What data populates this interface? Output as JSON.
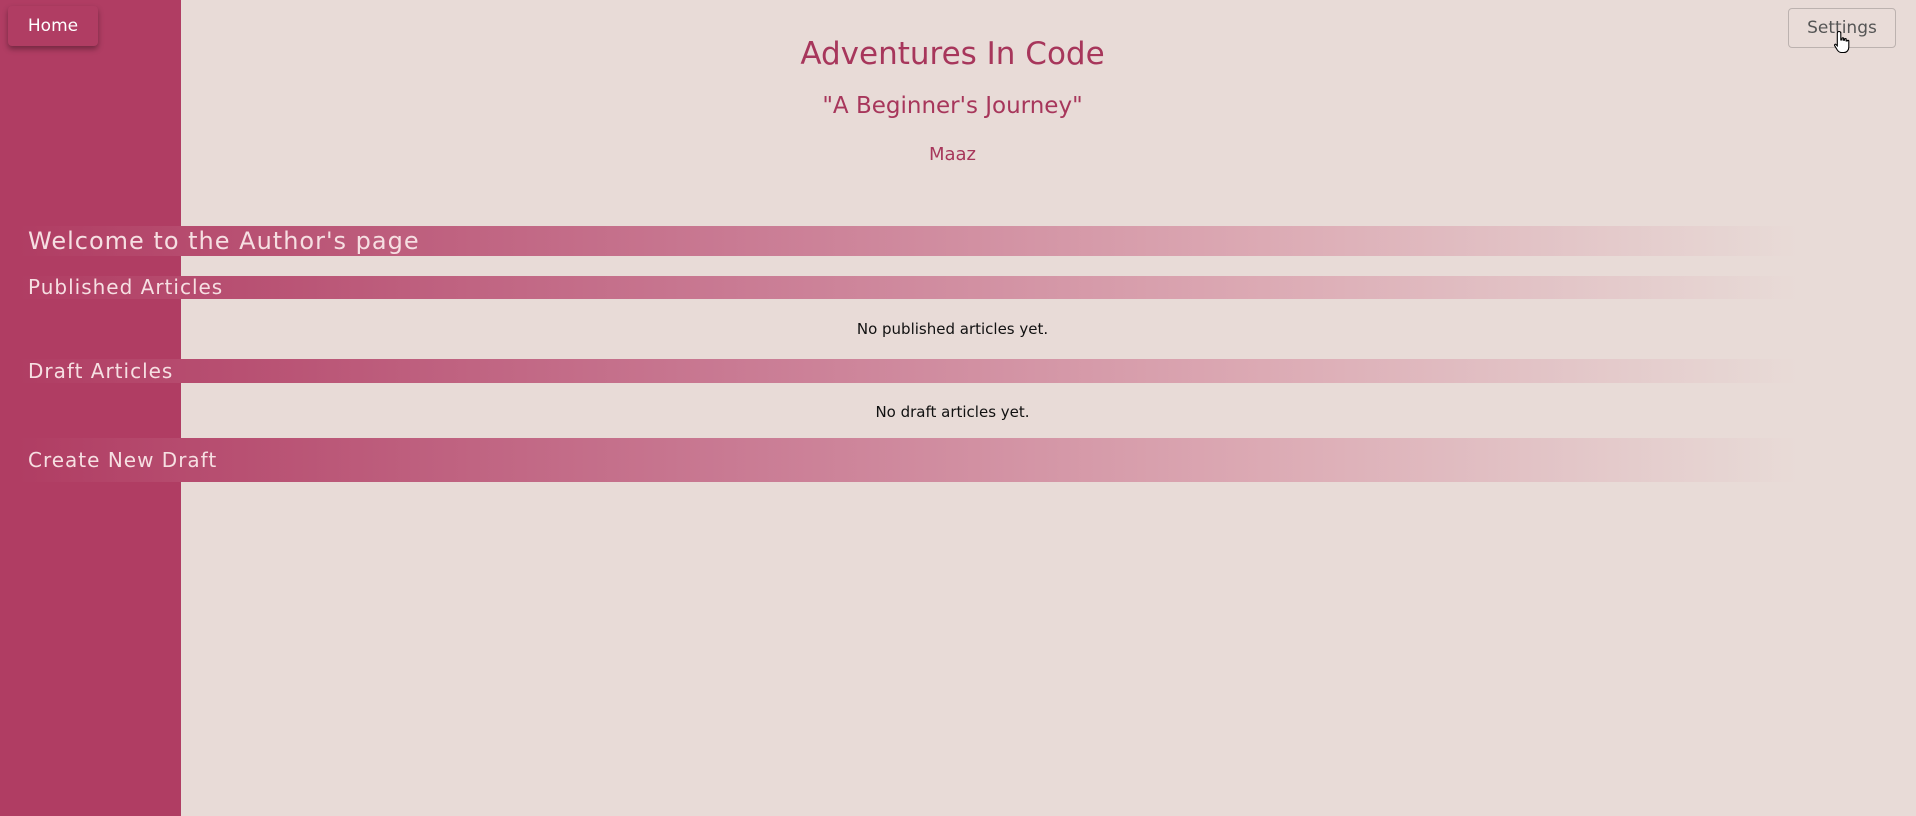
{
  "nav": {
    "home_label": "Home",
    "settings_label": "Settings"
  },
  "header": {
    "title": "Adventures In Code",
    "subtitle": "\"A Beginner's Journey\"",
    "author": "Maaz"
  },
  "sections": {
    "welcome": "Welcome to the Author's page",
    "published": {
      "heading": "Published Articles",
      "empty_message": "No published articles yet."
    },
    "drafts": {
      "heading": "Draft Articles",
      "empty_message": "No draft articles yet."
    },
    "create": "Create New Draft"
  },
  "colors": {
    "accent": "#b03d63",
    "background": "#e8dbd7",
    "title_text": "#a7365b"
  },
  "icons": {
    "cursor": "hand-pointer-icon"
  }
}
